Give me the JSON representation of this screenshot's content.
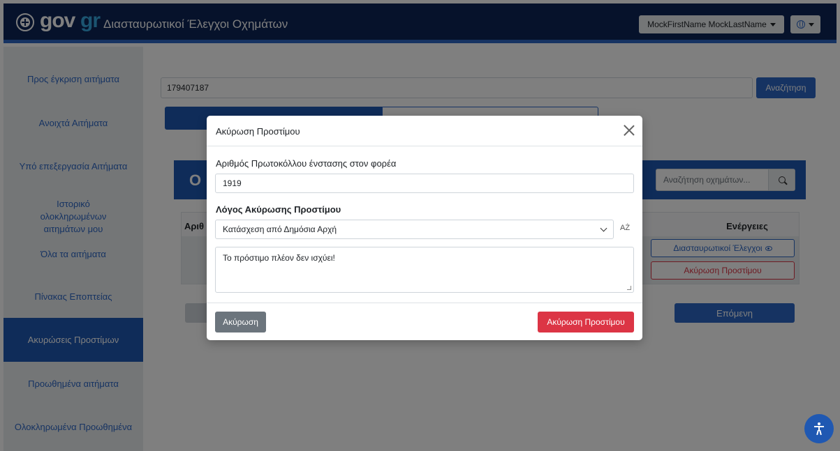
{
  "header": {
    "brand_gov": "gov",
    "brand_gr": "gr",
    "app_title": "Διασταυρωτικοί Έλεγχοι Οχημάτων",
    "user_name": "MockFirstName MockLastName"
  },
  "sidebar": {
    "items": [
      {
        "label": "Προς έγκριση αιτήματα"
      },
      {
        "label": "Ανοιχτά Αιτήματα"
      },
      {
        "label": "Υπό επεξεργασία Αιτήματα"
      },
      {
        "label": "Ιστορικό ολοκληρωμένων αιτημάτων μου"
      },
      {
        "label": "Όλα τα αιτήματα"
      },
      {
        "label": "Πίνακας Εποπτείας"
      },
      {
        "label": "Ακυρώσεις Προστίμων"
      },
      {
        "label": "Προωθημένα αιτήματα"
      },
      {
        "label": "Ολοκληρωμένα Προωθημένα"
      }
    ],
    "active_index": 6
  },
  "main": {
    "search_value": "179407187",
    "search_button": "Αναζήτηση",
    "banner_title": "Ο",
    "vehicle_search_placeholder": "Αναζήτηση οχημάτων...",
    "table": {
      "col_number": "Αριθ",
      "col_actions": "Ενέργειες"
    },
    "action_checks": "Διασταυρωτικοί Έλεγχοι",
    "action_cancel_fine": "Ακύρωση Προστίμου",
    "next_button": "Επόμενη"
  },
  "modal": {
    "title": "Ακύρωση Προστίμου",
    "protocol_label": "Αριθμός Πρωτοκόλλου ένστασης στον φορέα",
    "protocol_value": "1919",
    "reason_label": "Λόγος Ακύρωσης Προστίμου",
    "reason_selected": "Κατάσχεση από Δημόσια Αρχή",
    "sort_icon_text": "AŻ",
    "comment_value": "Το πρόστιμο πλέον δεν ισχύει!",
    "cancel_button": "Ακύρωση",
    "confirm_button": "Ακύρωση Προστίμου"
  },
  "colors": {
    "header_bg": "#0c2556",
    "primary": "#2d67c5",
    "danger": "#dc3545",
    "secondary": "#6c757d"
  },
  "icons": [
    "gov-logo-icon",
    "globe-icon",
    "search-icon",
    "eye-icon",
    "chevron-down-icon",
    "sort-icon",
    "close-icon",
    "accessibility-icon"
  ]
}
